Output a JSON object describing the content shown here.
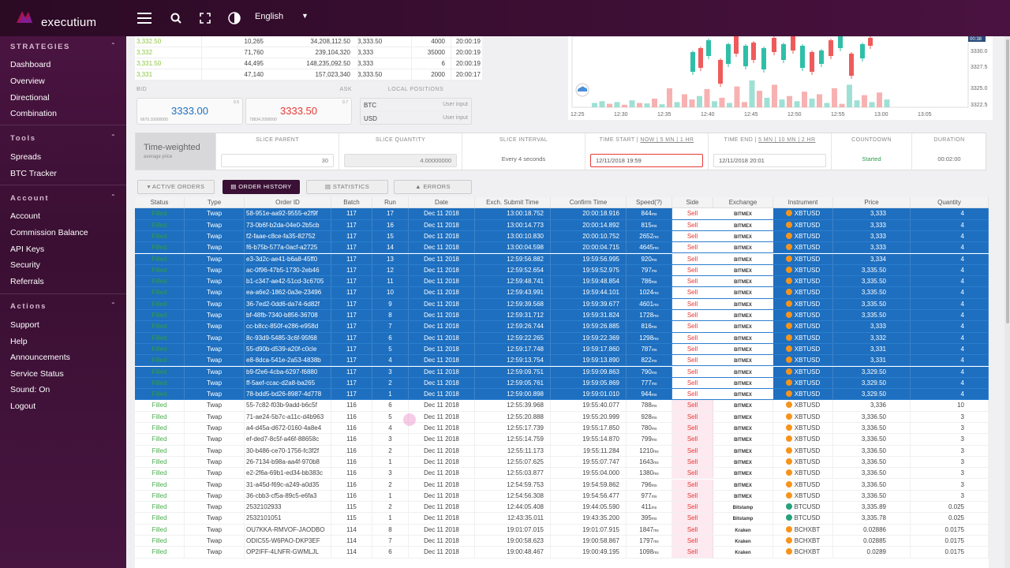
{
  "topbar": {
    "brand": "executium",
    "language": "English"
  },
  "sidebar": {
    "sections": [
      {
        "title": "STRATEGIES",
        "items": [
          "Dashboard",
          "Overview",
          "Directional",
          "Combination"
        ]
      },
      {
        "title": "Tools",
        "items": [
          "Spreads",
          "BTC Tracker"
        ]
      },
      {
        "title": "Account",
        "items": [
          "Account",
          "Commission Balance",
          "API Keys",
          "Security",
          "Referrals"
        ]
      },
      {
        "title": "Actions",
        "items": [
          "Support",
          "Help",
          "Announcements",
          "Service Status",
          "Sound: On",
          "Logout"
        ]
      }
    ]
  },
  "orderbook": {
    "rows": [
      [
        "3,332.50",
        "10,265",
        "34,208,112.50",
        "3,333.50",
        "4000",
        "20:00:19"
      ],
      [
        "3,332",
        "71,760",
        "239,104,320",
        "3,333",
        "35000",
        "20:00:19"
      ],
      [
        "3,331.50",
        "44,495",
        "148,235,092.50",
        "3,333",
        "6",
        "20:00:19"
      ],
      [
        "3,331",
        "47,140",
        "157,023,340",
        "3,333.50",
        "2000",
        "20:00:17"
      ]
    ]
  },
  "bidask": {
    "bid_label": "BID",
    "ask_label": "ASK",
    "bid": "3333.00",
    "ask": "3333.50",
    "bid_sub": "6670.10000000",
    "ask_sub": "79834.2000000",
    "bid_sup": "0.5",
    "ask_sup": "0.7"
  },
  "positions": {
    "title": "LOCAL POSITIONS",
    "rows": [
      [
        "BTC",
        "User input"
      ],
      [
        "USD",
        "User input"
      ]
    ]
  },
  "chart": {
    "x_ticks": [
      "12:25",
      "12:30",
      "12:35",
      "12:40",
      "12:45",
      "12:50",
      "12:55",
      "13:00",
      "13:05"
    ],
    "y_ticks": [
      "3330.0",
      "3327.5",
      "3325.0",
      "3322.5"
    ],
    "current": "00:38",
    "colors": {
      "up": "#2fbfa7",
      "down": "#ef5b5b",
      "vol_up": "#9fe0d4",
      "vol_down": "#f7b1b1"
    }
  },
  "algo": {
    "name": "Time-weighted",
    "sub": "average price",
    "slice_parent_label": "SLICE PARENT",
    "slice_parent": "30",
    "slice_qty_label": "SLICE QUANTITY",
    "slice_qty": "4.00000000",
    "slice_interval_label": "SLICE INTERVAL",
    "slice_interval": "Every 4 seconds",
    "time_start_label": "TIME START",
    "time_start_links": "NOW | 5 MN | 1 HR",
    "time_start": "12/11/2018 19:59",
    "time_end_label": "TIME END",
    "time_end_links": "5 MN | 10 MN | 2 HR",
    "time_end": "12/11/2018 20:01",
    "countdown_label": "COUNTDOWN",
    "countdown": "Started",
    "duration_label": "DURATION",
    "duration": "00:02:00"
  },
  "tabs": [
    "ACTIVE ORDERS",
    "ORDER HISTORY",
    "STATISTICS",
    "ERRORS"
  ],
  "table": {
    "headers": [
      "Status",
      "Type",
      "Order ID",
      "Batch",
      "Run",
      "Date",
      "Exch. Submit Time",
      "Confirm Time",
      "Speed(?)",
      "Side",
      "Exchange",
      "Instrument",
      "Price",
      "Quantity"
    ],
    "rows": [
      [
        "Filled",
        "Twap",
        "58-951e-aa92-9555-e2f9f",
        "117",
        "17",
        "Dec 11 2018",
        "13:00:18.752",
        "20:00:18.916",
        "844",
        "Sell",
        "BITMEX",
        "XBTUSD",
        "3,333",
        "4",
        "sel"
      ],
      [
        "Filled",
        "Twap",
        "73-0b6f-b2da-04e0-2b5cb",
        "117",
        "16",
        "Dec 11 2018",
        "13:00:14.773",
        "20:00:14.892",
        "815",
        "Sell",
        "BITMEX",
        "XBTUSD",
        "3,333",
        "4",
        "sel"
      ],
      [
        "Filled",
        "Twap",
        "f2-faae-c8ce-fa35-82752",
        "117",
        "15",
        "Dec 11 2018",
        "13:00:10.830",
        "20:00:10.752",
        "2652",
        "Sell",
        "BITMEX",
        "XBTUSD",
        "3,333",
        "4",
        "sel"
      ],
      [
        "Filled",
        "Twap",
        "f6-b75b-577a-0acf-a2725",
        "117",
        "14",
        "Dec 11 2018",
        "13:00:04.598",
        "20:00:04.715",
        "4645",
        "Sell",
        "BITMEX",
        "XBTUSD",
        "3,333",
        "4",
        "sel"
      ],
      [
        "Filled",
        "Twap",
        "e3-3d2c-ae41-b6a8-45ff0",
        "117",
        "13",
        "Dec 11 2018",
        "12:59:56.882",
        "19:59:56.995",
        "920",
        "Sell",
        "BITMEX",
        "XBTUSD",
        "3,334",
        "4",
        "sel"
      ],
      [
        "Filled",
        "Twap",
        "ac-0f96-47b5-1730-2eb46",
        "117",
        "12",
        "Dec 11 2018",
        "12:59:52.654",
        "19:59:52.975",
        "797",
        "Sell",
        "BITMEX",
        "XBTUSD",
        "3,335.50",
        "4",
        "sel"
      ],
      [
        "Filled",
        "Twap",
        "b1-c347-ae42-51cd-3c6705",
        "117",
        "11",
        "Dec 11 2018",
        "12:59:48.741",
        "19:59:48.854",
        "786",
        "Sell",
        "BITMEX",
        "XBTUSD",
        "3,335.50",
        "4",
        "sel"
      ],
      [
        "Filled",
        "Twap",
        "ea-a6e2-1862-0a3e-23496",
        "117",
        "10",
        "Dec 11 2018",
        "12:59:43.991",
        "19:59:44.101",
        "1024",
        "Sell",
        "BITMEX",
        "XBTUSD",
        "3,335.50",
        "4",
        "sel"
      ],
      [
        "Filled",
        "Twap",
        "36-7ed2-0dd6-da74-6d82f",
        "117",
        "9",
        "Dec 11 2018",
        "12:59:39.568",
        "19:59:39.677",
        "4601",
        "Sell",
        "BITMEX",
        "XBTUSD",
        "3,335.50",
        "4",
        "sel"
      ],
      [
        "Filled",
        "Twap",
        "bf-48fb-7340-b856-36708",
        "117",
        "8",
        "Dec 11 2018",
        "12:59:31.712",
        "19:59:31.824",
        "1728",
        "Sell",
        "BITMEX",
        "XBTUSD",
        "3,335.50",
        "4",
        "sel"
      ],
      [
        "Filled",
        "Twap",
        "cc-b8cc-850f-e286-e958d",
        "117",
        "7",
        "Dec 11 2018",
        "12:59:26.744",
        "19:59:26.885",
        "816",
        "Sell",
        "BITMEX",
        "XBTUSD",
        "3,333",
        "4",
        "sel"
      ],
      [
        "Filled",
        "Twap",
        "8c-93d9-5485-3c6f-95f68",
        "117",
        "6",
        "Dec 11 2018",
        "12:59:22.265",
        "19:59:22.369",
        "1298",
        "Sell",
        "BITMEX",
        "XBTUSD",
        "3,332",
        "4",
        "sel"
      ],
      [
        "Filled",
        "Twap",
        "55-d90b-d539-a20f-c0cle",
        "117",
        "5",
        "Dec 11 2018",
        "12:59:17.748",
        "19:59:17.860",
        "787",
        "Sell",
        "BITMEX",
        "XBTUSD",
        "3,331",
        "4",
        "sel"
      ],
      [
        "Filled",
        "Twap",
        "e8-8dca-541e-2a53-4838b",
        "117",
        "4",
        "Dec 11 2018",
        "12:59:13.754",
        "19:59:13.890",
        "822",
        "Sell",
        "BITMEX",
        "XBTUSD",
        "3,331",
        "4",
        "sel"
      ],
      [
        "Filled",
        "Twap",
        "b9-f2e6-4cba-6297-f6880",
        "117",
        "3",
        "Dec 11 2018",
        "12:59:09.751",
        "19:59:09.863",
        "790",
        "Sell",
        "BITMEX",
        "XBTUSD",
        "3,329.50",
        "4",
        "sel"
      ],
      [
        "Filled",
        "Twap",
        "ff-5aef-ccac-d2a8-ba265",
        "117",
        "2",
        "Dec 11 2018",
        "12:59:05.761",
        "19:59:05.869",
        "777",
        "Sell",
        "BITMEX",
        "XBTUSD",
        "3,329.50",
        "4",
        "sel"
      ],
      [
        "Filled",
        "Twap",
        "78-bdd5-bd26-8987-4d778",
        "117",
        "1",
        "Dec 11 2018",
        "12:59:00.898",
        "19:59:01.010",
        "944",
        "Sell",
        "BITMEX",
        "XBTUSD",
        "3,329.50",
        "4",
        "sel"
      ],
      [
        "Filled",
        "Twap",
        "55-7c82-f03b-9add-b6c5f",
        "116",
        "6",
        "Dec 11 2018",
        "12:55:39.968",
        "19:55:40.077",
        "788",
        "Sell",
        "BITMEX",
        "XBTUSD",
        "3,336",
        "10",
        ""
      ],
      [
        "Filled",
        "Twap",
        "71-ae24-5b7c-a11c-d4b963",
        "116",
        "5",
        "Dec 11 2018",
        "12:55:20.888",
        "19:55:20.999",
        "928",
        "Sell",
        "BITMEX",
        "XBTUSD",
        "3,336.50",
        "3",
        ""
      ],
      [
        "Filled",
        "Twap",
        "a4-d45a-d672-0160-4a8e4",
        "116",
        "4",
        "Dec 11 2018",
        "12:55:17.739",
        "19:55:17.850",
        "780",
        "Sell",
        "BITMEX",
        "XBTUSD",
        "3,336.50",
        "3",
        ""
      ],
      [
        "Filled",
        "Twap",
        "ef-ded7-8c5f-a46f-88658c",
        "116",
        "3",
        "Dec 11 2018",
        "12:55:14.759",
        "19:55:14.870",
        "799",
        "Sell",
        "BITMEX",
        "XBTUSD",
        "3,336.50",
        "3",
        ""
      ],
      [
        "Filled",
        "Twap",
        "30-b486-ce70-1756-fc3f2f",
        "116",
        "2",
        "Dec 11 2018",
        "12:55:11.173",
        "19:55:11.284",
        "1210",
        "Sell",
        "BITMEX",
        "XBTUSD",
        "3,336.50",
        "3",
        ""
      ],
      [
        "Filled",
        "Twap",
        "26-7134-b98a-aa4f-970b8",
        "116",
        "1",
        "Dec 11 2018",
        "12:55:07.625",
        "19:55:07.747",
        "1643",
        "Sell",
        "BITMEX",
        "XBTUSD",
        "3,336.50",
        "3",
        ""
      ],
      [
        "Filled",
        "Twap",
        "e2-2f6a-69b1-ed34-bb383c",
        "116",
        "3",
        "Dec 11 2018",
        "12:55:03.877",
        "19:55:04.000",
        "1380",
        "Sell",
        "BITMEX",
        "XBTUSD",
        "3,336.50",
        "3",
        ""
      ],
      [
        "Filled",
        "Twap",
        "31-a45d-f69c-a249-a0d35",
        "116",
        "2",
        "Dec 11 2018",
        "12:54:59.753",
        "19:54:59.862",
        "796",
        "Sell",
        "BITMEX",
        "XBTUSD",
        "3,336.50",
        "3",
        ""
      ],
      [
        "Filled",
        "Twap",
        "36-cbb3-cf5a-89c5-e6fa3",
        "116",
        "1",
        "Dec 11 2018",
        "12:54:56.308",
        "19:54:56.477",
        "977",
        "Sell",
        "BITMEX",
        "XBTUSD",
        "3,336.50",
        "3",
        ""
      ],
      [
        "Filled",
        "Twap",
        "2532102933",
        "115",
        "2",
        "Dec 11 2018",
        "12:44:05.408",
        "19:44:05.590",
        "411",
        "Sell",
        "Bitstamp",
        "BTCUSD",
        "3,335.89",
        "0.025",
        ""
      ],
      [
        "Filled",
        "Twap",
        "2532101051",
        "115",
        "1",
        "Dec 11 2018",
        "12:43:35.011",
        "19:43:35.200",
        "395",
        "Sell",
        "Bitstamp",
        "BTCUSD",
        "3,335.78",
        "0.025",
        ""
      ],
      [
        "Filled",
        "Twap",
        "OU7KKA-RMVOF-JAODBO",
        "114",
        "8",
        "Dec 11 2018",
        "19:01:07.015",
        "19:01:07.915",
        "1847",
        "Sell",
        "Kraken",
        "BCHXBT",
        "0.02886",
        "0.0175",
        ""
      ],
      [
        "Filled",
        "Twap",
        "ODIC55-W6PAO-DKP3EF",
        "114",
        "7",
        "Dec 11 2018",
        "19:00:58.623",
        "19:00:58.867",
        "1797",
        "Sell",
        "Kraken",
        "BCHXBT",
        "0.02885",
        "0.0175",
        ""
      ],
      [
        "Filled",
        "Twap",
        "OP2IFF-4LNFR-GWMLJL",
        "114",
        "6",
        "Dec 11 2018",
        "19:00:48.467",
        "19:00:49.195",
        "1098",
        "Sell",
        "Kraken",
        "BCHXBT",
        "0.0289",
        "0.0175",
        ""
      ]
    ]
  }
}
